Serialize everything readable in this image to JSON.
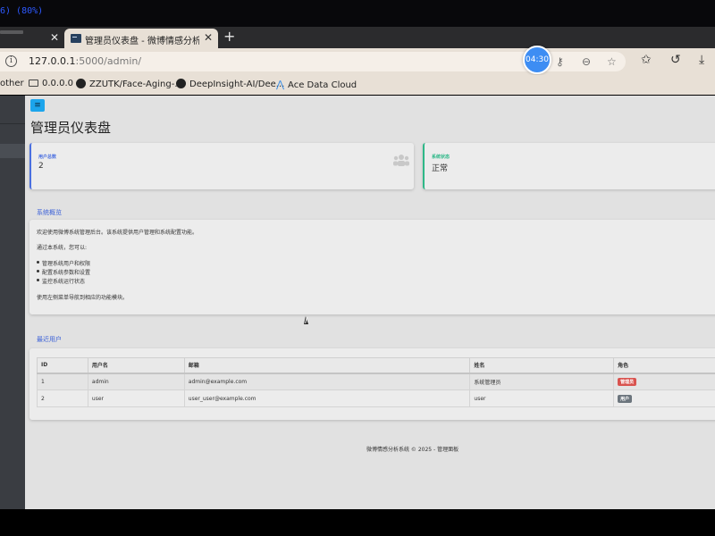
{
  "top": {
    "zoom_fragment": "6) (80%)"
  },
  "browser": {
    "tabs": [
      {
        "label": "",
        "close": "✕"
      },
      {
        "label": "管理员仪表盘 - 微博情感分析系统",
        "close": "✕"
      }
    ],
    "new_tab": "+",
    "address": {
      "host": "127.0.0.1",
      "path": ":5000/admin/"
    },
    "timer": "04:30",
    "bookmarks": [
      {
        "label": "other",
        "icon": "none"
      },
      {
        "label": "0.0.0.0",
        "icon": "folder-icon"
      },
      {
        "label": "ZZUTK/Face-Aging-...",
        "icon": "github-icon"
      },
      {
        "label": "DeepInsight-AI/Dee...",
        "icon": "github-icon"
      },
      {
        "label": "Ace Data Cloud",
        "icon": "ace-icon"
      }
    ]
  },
  "dashboard": {
    "menu_icon": "≡",
    "title": "管理员仪表盘",
    "stats": [
      {
        "label": "用户总数",
        "value": "2",
        "accent": "#4a6fe0"
      },
      {
        "label": "系统状态",
        "value": "正常",
        "accent": "#2eb888"
      }
    ],
    "overview": {
      "heading": "系统概览",
      "intro": "欢迎使用微博系统管理后台。该系统提供用户管理和系统配置功能。",
      "lead": "通过本系统，您可以:",
      "items": [
        "管理系统用户和权限",
        "配置系统参数和设置",
        "监控系统运行状态"
      ],
      "outro": "使用左侧菜单导航到相应的功能模块。"
    },
    "recent_users": {
      "heading": "最近用户",
      "columns": [
        "ID",
        "用户名",
        "邮箱",
        "姓名",
        "角色"
      ],
      "rows": [
        {
          "id": "1",
          "username": "admin",
          "email": "admin@example.com",
          "name": "系统管理员",
          "role": "管理员",
          "role_color": "#d9534f"
        },
        {
          "id": "2",
          "username": "user",
          "email": "user_user@example.com",
          "name": "user",
          "role": "用户",
          "role_color": "#6c757d"
        }
      ]
    },
    "footer": "微博情感分析系统 © 2025 - 管理面板"
  }
}
